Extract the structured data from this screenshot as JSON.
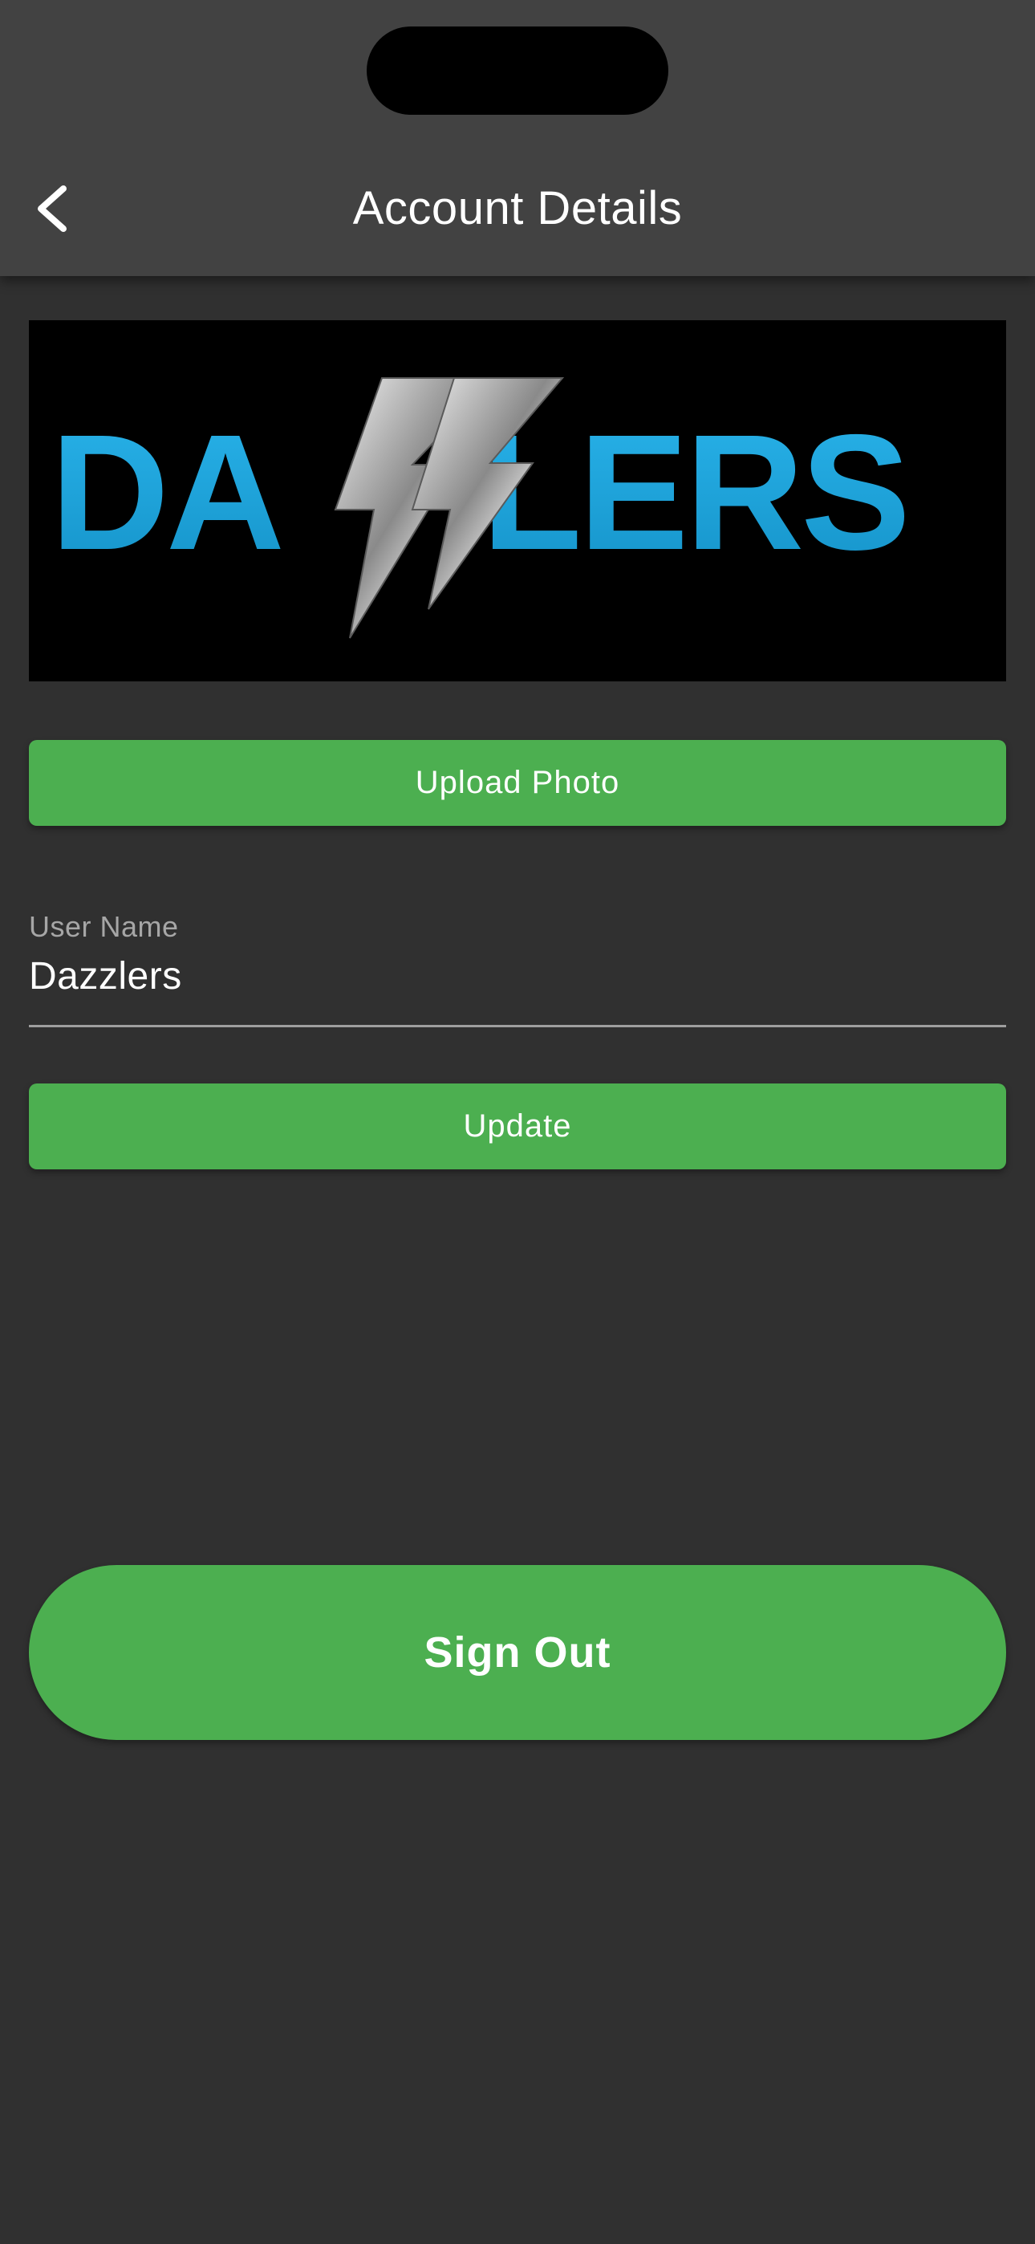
{
  "header": {
    "title": "Account Details",
    "back_icon": "chevron-left-icon"
  },
  "profile": {
    "logo_text": "DAZZLERS",
    "logo_colors": {
      "letters": "#1ba3dc",
      "bolt": "#c7c7c7",
      "background": "#000000"
    }
  },
  "actions": {
    "upload_label": "Upload Photo",
    "update_label": "Update",
    "signout_label": "Sign Out"
  },
  "username_field": {
    "label": "User Name",
    "value": "Dazzlers"
  },
  "colors": {
    "accent": "#4caf50",
    "app_bar": "#424242",
    "background": "#303030"
  }
}
